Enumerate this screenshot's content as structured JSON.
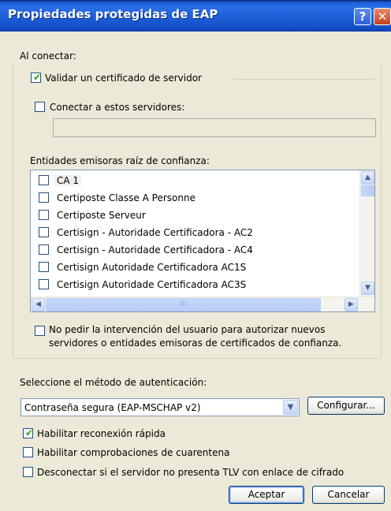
{
  "window": {
    "title": "Propiedades protegidas de EAP",
    "help_label": "?",
    "close_label": "✕"
  },
  "connect_section": {
    "heading": "Al conectar:",
    "validate_cert": {
      "label": "Validar un certificado de servidor",
      "checked": true
    },
    "connect_servers": {
      "label": "Conectar a estos servidores:",
      "checked": false,
      "value": ""
    }
  },
  "trusted_roots": {
    "heading": "Entidades emisoras raíz de confianza:",
    "items": [
      {
        "label": "CA 1",
        "checked": false
      },
      {
        "label": "Certiposte Classe A Personne",
        "checked": false
      },
      {
        "label": "Certiposte Serveur",
        "checked": false
      },
      {
        "label": "Certisign - Autoridade Certificadora - AC2",
        "checked": false
      },
      {
        "label": "Certisign - Autoridade Certificadora - AC4",
        "checked": false
      },
      {
        "label": "Certisign Autoridade Certificadora AC1S",
        "checked": false
      },
      {
        "label": "Certisign Autoridade Certificadora AC3S",
        "checked": false
      }
    ],
    "scroll_up_label": "▲",
    "scroll_down_label": "▼",
    "scroll_left_label": "◀",
    "scroll_right_label": "▶",
    "hthumb_grip": "III"
  },
  "no_prompt": {
    "label_line1": "No pedir la intervención del usuario para autorizar nuevos",
    "label_line2": "servidores o entidades emisoras de certificados de confianza.",
    "checked": false
  },
  "auth": {
    "heading": "Seleccione el método de autenticación:",
    "selected": "Contraseña segura (EAP-MSCHAP v2)",
    "arrow": "▼",
    "configure_label": "Configurar..."
  },
  "options": [
    {
      "label": "Habilitar reconexión rápida",
      "checked": true
    },
    {
      "label": "Habilitar comprobaciones de cuarentena",
      "checked": false
    },
    {
      "label": "Desconectar si el servidor no presenta TLV con enlace de cifrado",
      "checked": false
    }
  ],
  "footer": {
    "ok_label": "Aceptar",
    "cancel_label": "Cancelar"
  },
  "colors": {
    "title_bar": "#1d5ed8",
    "dialog_bg": "#ece9d8",
    "checkmark": "#21a121"
  }
}
